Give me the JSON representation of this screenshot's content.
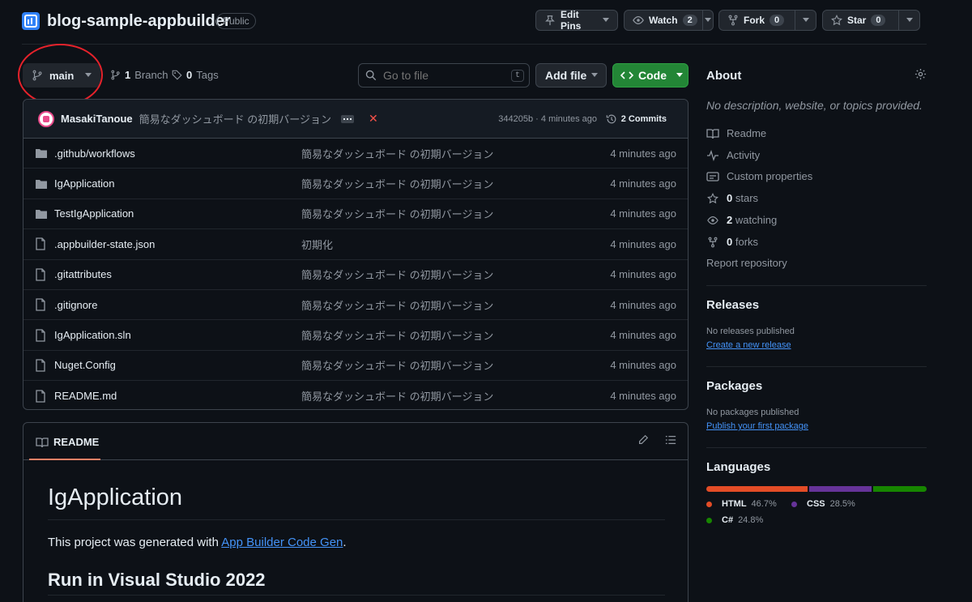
{
  "repo": {
    "name": "blog-sample-appbuilder",
    "visibility": "Public"
  },
  "header_actions": {
    "edit_pins": "Edit Pins",
    "watch": "Watch",
    "watch_count": "2",
    "fork": "Fork",
    "fork_count": "0",
    "star": "Star",
    "star_count": "0"
  },
  "toolbar": {
    "branch": "main",
    "branch_count": "1",
    "branch_label": "Branch",
    "tags_count": "0",
    "tags_label": "Tags",
    "search_placeholder": "Go to file",
    "search_shortcut": "t",
    "add_file": "Add file",
    "code": "Code"
  },
  "latest_commit": {
    "author": "MasakiTanoue",
    "message": "簡易なダッシュボード の初期バージョン",
    "meta": "344205b · 4 minutes ago",
    "commits": "2 Commits"
  },
  "files": [
    {
      "name": ".github/workflows",
      "type": "folder",
      "message": "簡易なダッシュボード の初期バージョン",
      "time": "4 minutes ago"
    },
    {
      "name": "IgApplication",
      "type": "folder",
      "message": "簡易なダッシュボード の初期バージョン",
      "time": "4 minutes ago"
    },
    {
      "name": "TestIgApplication",
      "type": "folder",
      "message": "簡易なダッシュボード の初期バージョン",
      "time": "4 minutes ago"
    },
    {
      "name": ".appbuilder-state.json",
      "type": "file",
      "message": "初期化",
      "time": "4 minutes ago"
    },
    {
      "name": ".gitattributes",
      "type": "file",
      "message": "簡易なダッシュボード の初期バージョン",
      "time": "4 minutes ago"
    },
    {
      "name": ".gitignore",
      "type": "file",
      "message": "簡易なダッシュボード の初期バージョン",
      "time": "4 minutes ago"
    },
    {
      "name": "IgApplication.sln",
      "type": "file",
      "message": "簡易なダッシュボード の初期バージョン",
      "time": "4 minutes ago"
    },
    {
      "name": "Nuget.Config",
      "type": "file",
      "message": "簡易なダッシュボード の初期バージョン",
      "time": "4 minutes ago"
    },
    {
      "name": "README.md",
      "type": "file",
      "message": "簡易なダッシュボード の初期バージョン",
      "time": "4 minutes ago"
    }
  ],
  "readme": {
    "tab": "README",
    "h1": "IgApplication",
    "p_prefix": "This project was generated with ",
    "p_link": "App Builder Code Gen",
    "p_suffix": ".",
    "h2": "Run in Visual Studio 2022"
  },
  "about": {
    "title": "About",
    "description": "No description, website, or topics provided.",
    "readme": "Readme",
    "activity": "Activity",
    "custom_properties": "Custom properties",
    "stars_count": "0",
    "stars_label": "stars",
    "watching_count": "2",
    "watching_label": "watching",
    "forks_count": "0",
    "forks_label": "forks",
    "report": "Report repository"
  },
  "releases": {
    "title": "Releases",
    "empty": "No releases published",
    "link": "Create a new release"
  },
  "packages": {
    "title": "Packages",
    "empty": "No packages published",
    "link": "Publish your first package"
  },
  "languages": {
    "title": "Languages",
    "items": [
      {
        "name": "HTML",
        "percent": "46.7%",
        "value": 46.7,
        "color": "#e34c26"
      },
      {
        "name": "CSS",
        "percent": "28.5%",
        "value": 28.5,
        "color": "#663399"
      },
      {
        "name": "C#",
        "percent": "24.8%",
        "value": 24.8,
        "color": "#178600"
      }
    ]
  },
  "colors": {
    "background": "#0d1117",
    "accent_green": "#238636",
    "link": "#4493f8",
    "annotation_circle": "#e5222b"
  }
}
